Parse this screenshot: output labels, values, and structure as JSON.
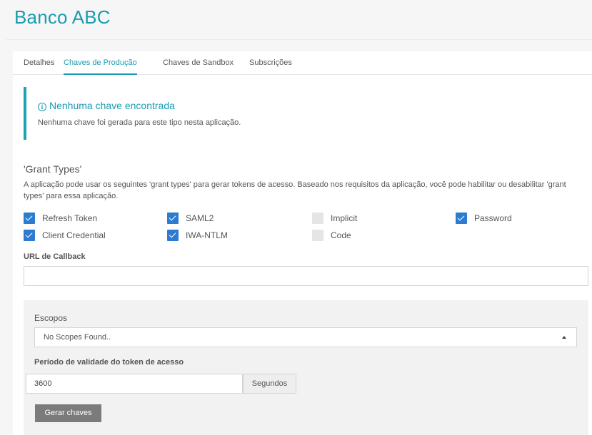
{
  "app": {
    "title": "Banco ABC"
  },
  "tabs": [
    {
      "label": "Detalhes",
      "active": false
    },
    {
      "label": "Chaves de Produção",
      "active": true
    },
    {
      "label": "Chaves de Sandbox",
      "active": false
    },
    {
      "label": "Subscrições",
      "active": false
    }
  ],
  "alert": {
    "icon": "info-icon",
    "title": "Nenhuma chave encontrada",
    "text": "Nenhuma chave foi gerada para este tipo nesta aplicação."
  },
  "grant_types": {
    "title": "'Grant Types'",
    "description": "A aplicação pode usar os seguintes 'grant types' para gerar tokens de acesso. Baseado nos requisitos da aplicação, você pode habilitar ou desabilitar 'grant types' para essa aplicação.",
    "options": [
      {
        "label": "Refresh Token",
        "checked": true
      },
      {
        "label": "SAML2",
        "checked": true
      },
      {
        "label": "Implicit",
        "checked": false
      },
      {
        "label": "Password",
        "checked": true
      },
      {
        "label": "Client Credential",
        "checked": true
      },
      {
        "label": "IWA-NTLM",
        "checked": true
      },
      {
        "label": "Code",
        "checked": false
      }
    ]
  },
  "callback": {
    "label": "URL de Callback",
    "value": ""
  },
  "scopes": {
    "label": "Escopos",
    "value": "No Scopes Found.."
  },
  "validity": {
    "label": "Período de validade do token de acesso",
    "value": "3600",
    "unit": "Segundos"
  },
  "generate_button": {
    "label": "Gerar chaves"
  },
  "colors": {
    "accent": "#1a9cb0",
    "checkbox": "#2d7bd0",
    "button": "#7b7b7b"
  }
}
